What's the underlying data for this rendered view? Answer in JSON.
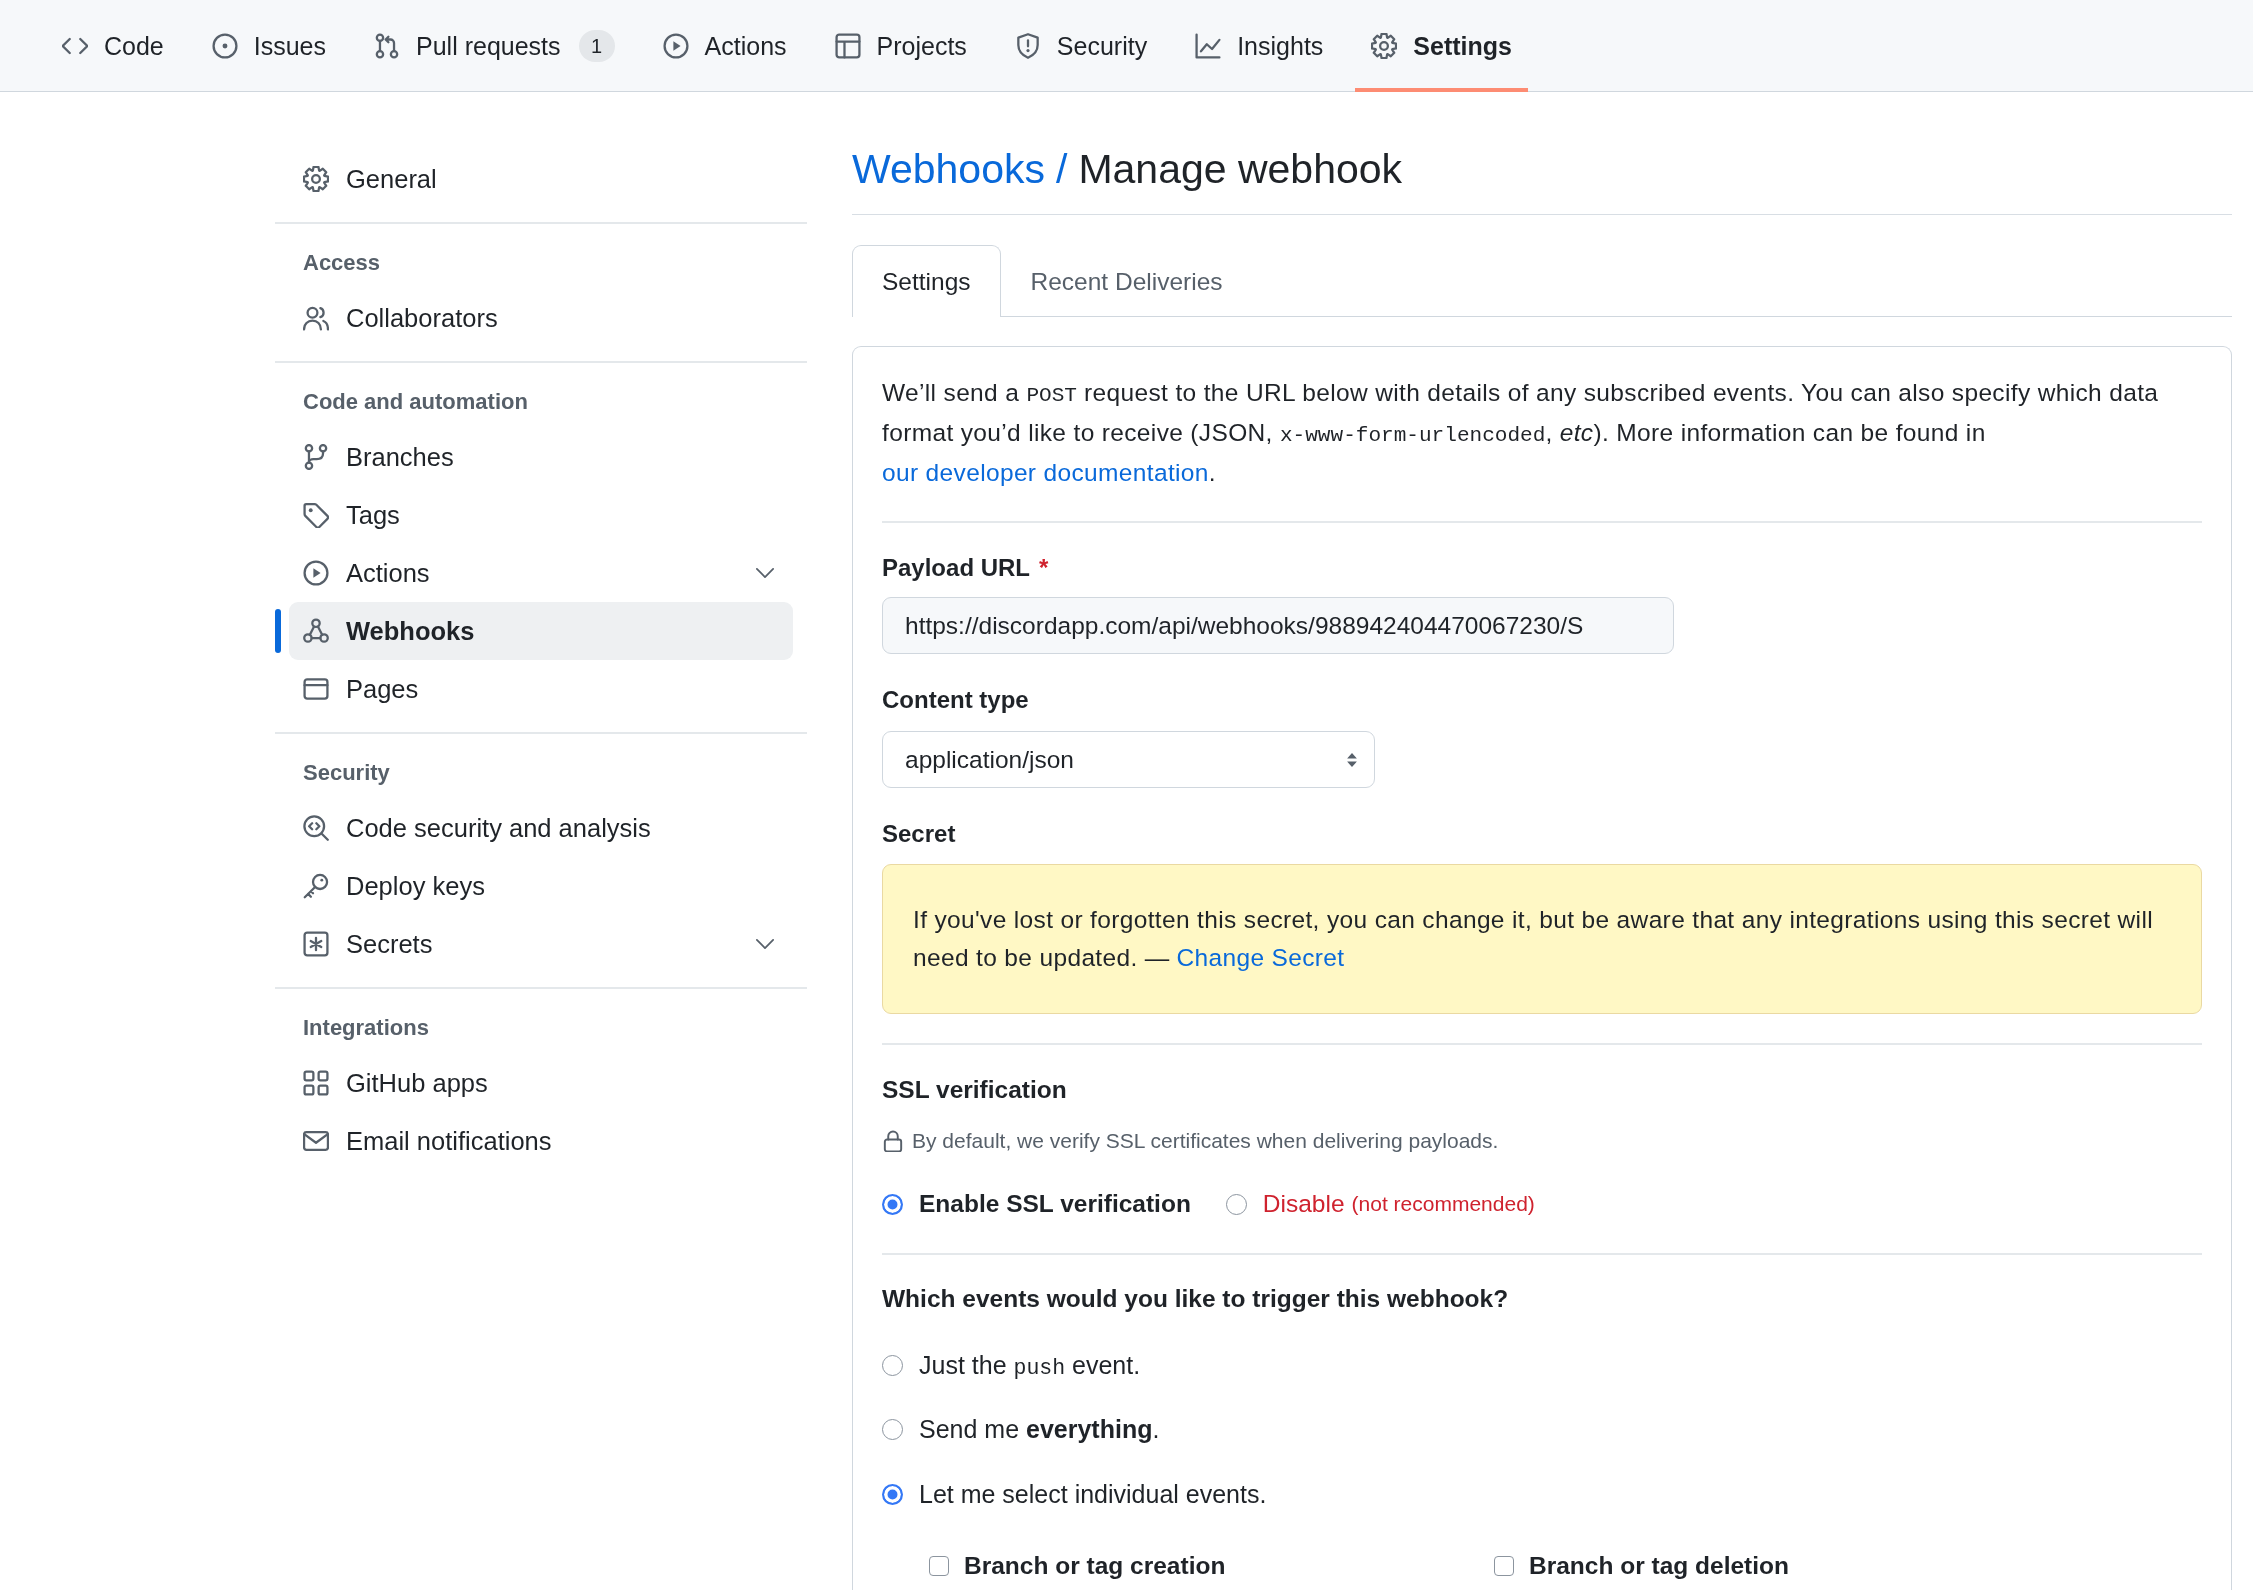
{
  "repo_nav": {
    "tabs": [
      {
        "label": "Code",
        "selected": false
      },
      {
        "label": "Issues",
        "selected": false
      },
      {
        "label": "Pull requests",
        "count": "1",
        "selected": false
      },
      {
        "label": "Actions",
        "selected": false
      },
      {
        "label": "Projects",
        "selected": false
      },
      {
        "label": "Security",
        "selected": false
      },
      {
        "label": "Insights",
        "selected": false
      },
      {
        "label": "Settings",
        "selected": true
      }
    ]
  },
  "sidebar": {
    "groups": [
      {
        "items": [
          {
            "label": "General",
            "kind": "page",
            "selected": false
          }
        ]
      },
      {
        "heading": "Access",
        "items": [
          {
            "label": "Collaborators",
            "kind": "page",
            "selected": false
          }
        ]
      },
      {
        "heading": "Code and automation",
        "items": [
          {
            "label": "Branches",
            "kind": "page",
            "selected": false
          },
          {
            "label": "Tags",
            "kind": "page",
            "selected": false
          },
          {
            "label": "Actions",
            "kind": "menu",
            "selected": false
          },
          {
            "label": "Webhooks",
            "kind": "page",
            "selected": true
          },
          {
            "label": "Pages",
            "kind": "page",
            "selected": false
          }
        ]
      },
      {
        "heading": "Security",
        "items": [
          {
            "label": "Code security and analysis",
            "kind": "page",
            "selected": false
          },
          {
            "label": "Deploy keys",
            "kind": "page",
            "selected": false
          },
          {
            "label": "Secrets",
            "kind": "menu",
            "selected": false
          }
        ]
      },
      {
        "heading": "Integrations",
        "items": [
          {
            "label": "GitHub apps",
            "kind": "page",
            "selected": false
          },
          {
            "label": "Email notifications",
            "kind": "page",
            "selected": false
          }
        ]
      }
    ]
  },
  "header": {
    "breadcrumb": {
      "parent": "Webhooks",
      "separator": "/",
      "current": "Manage webhook"
    }
  },
  "tabs": [
    {
      "label": "Settings",
      "selected": true
    },
    {
      "label": "Recent Deliveries",
      "selected": false
    }
  ],
  "intro": [
    {
      "kind": "text",
      "text": "We’ll send a "
    },
    {
      "kind": "code",
      "text": "POST"
    },
    {
      "kind": "text",
      "text": " request to the URL below with details of any subscribed events. You can also specify which data format you’d like to receive (JSON, "
    },
    {
      "kind": "code",
      "text": "x-www-form-urlencoded"
    },
    {
      "kind": "text",
      "text": ", *etc*). More information can be found in "
    },
    {
      "kind": "link",
      "text": "our developer documentation"
    },
    {
      "kind": "text",
      "text": "."
    }
  ],
  "payload_url": {
    "label": "Payload URL",
    "required_mark": "*",
    "value": "https://discordapp.com/api/webhooks/988942404470067230/S"
  },
  "content_type": {
    "label": "Content type",
    "value": "application/json"
  },
  "secret": {
    "label": "Secret",
    "notice": "If you've lost or forgotten this secret, you can change it, but be aware that any integrations using this secret will need to be updated. —",
    "link": "Change Secret"
  },
  "ssl": {
    "heading": "SSL verification",
    "note": "By default, we verify SSL certificates when delivering payloads.",
    "options": [
      {
        "label": "Enable SSL verification",
        "kind": "default",
        "selected": true
      },
      {
        "label": "Disable",
        "hint": "(not recommended)",
        "kind": "danger",
        "selected": false
      }
    ]
  },
  "events": {
    "question": "Which events would you like to trigger this webhook?",
    "options": [
      {
        "selected": false,
        "parts": [
          {
            "kind": "text",
            "text": "Just the "
          },
          {
            "kind": "code",
            "text": "push"
          },
          {
            "kind": "text",
            "text": " event."
          }
        ]
      },
      {
        "selected": false,
        "parts": [
          {
            "kind": "text",
            "text": "Send me **everything**."
          }
        ]
      },
      {
        "selected": true,
        "parts": [
          {
            "kind": "text",
            "text": "Let me select individual events."
          }
        ]
      }
    ],
    "individual": [
      {
        "label": "Branch or tag creation",
        "checked": false
      },
      {
        "label": "Branch or tag deletion",
        "checked": false
      }
    ]
  }
}
